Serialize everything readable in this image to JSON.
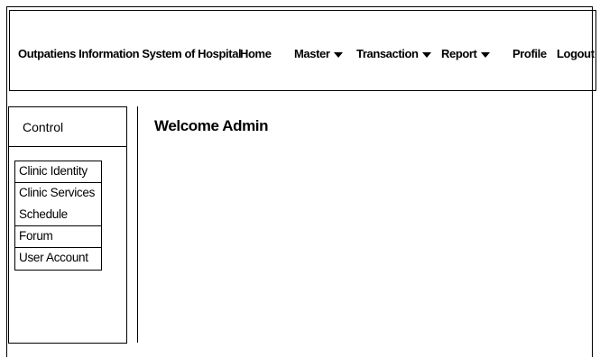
{
  "navbar": {
    "brand": "Outpatiens Information System of Hospital",
    "home": "Home",
    "master": "Master",
    "transaction": "Transaction",
    "report": "Report",
    "profile": "Profile",
    "logout": "Logout"
  },
  "sidebar": {
    "title": "Control",
    "items": [
      {
        "label": "Clinic Identity"
      },
      {
        "label": "Clinic Services"
      },
      {
        "label": "Schedule"
      },
      {
        "label": "Forum"
      },
      {
        "label": "User Account"
      }
    ]
  },
  "main": {
    "welcome": "Welcome Admin"
  }
}
